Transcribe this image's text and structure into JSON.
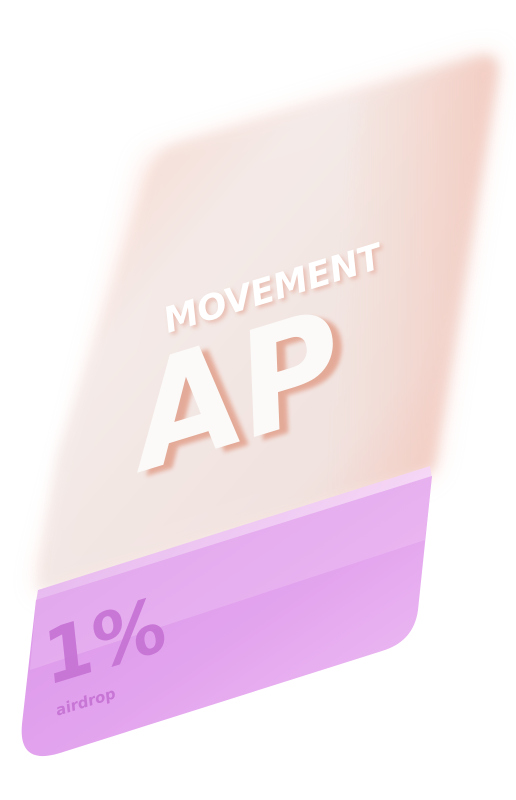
{
  "card": {
    "brand": "MOVEMENT",
    "title": "AP",
    "percent": "1%",
    "percent_label": "airdrop"
  },
  "colors": {
    "glass_top": "#f8c7b6",
    "glass_mid": "#f3e9e7",
    "glass_edge": "#f3b3a4",
    "base_pink": "#dd98e8",
    "base_pink_light": "#f2c8f5",
    "base_text": "#c86fd6",
    "text_white": "#ffffff",
    "text_shadow": "#e8a48e"
  }
}
